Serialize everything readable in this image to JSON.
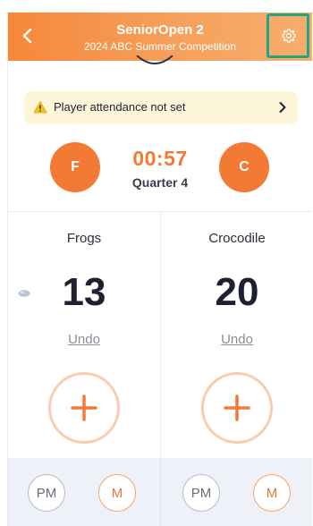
{
  "header": {
    "title": "SeniorOpen 2",
    "subtitle": "2024 ABC Summer Competition"
  },
  "banner": {
    "text": "Player attendance not set"
  },
  "match": {
    "clock": "00:57",
    "quarter": "Quarter 4"
  },
  "teams": [
    {
      "button_label": "F",
      "name": "Frogs",
      "score": "13",
      "undo_label": "Undo"
    },
    {
      "button_label": "C",
      "name": "Crocodile",
      "score": "20",
      "undo_label": "Undo"
    }
  ],
  "footer": {
    "left": {
      "pm_label": "PM",
      "m_label": "M"
    },
    "right": {
      "pm_label": "PM",
      "m_label": "M"
    }
  },
  "colors": {
    "accent": "#f27a35",
    "header_gradient_start": "#f6873a",
    "header_gradient_end": "#f7ad6c",
    "settings_highlight": "#1fa58a",
    "banner_bg": "#fdf6d9",
    "footer_bg": "#eef2f8"
  },
  "icons": {
    "back": "chevron-left-icon",
    "settings": "gear-icon",
    "warning": "warning-icon",
    "banner_chevron": "chevron-right-icon",
    "add": "plus-icon",
    "possession": "ball-icon"
  }
}
